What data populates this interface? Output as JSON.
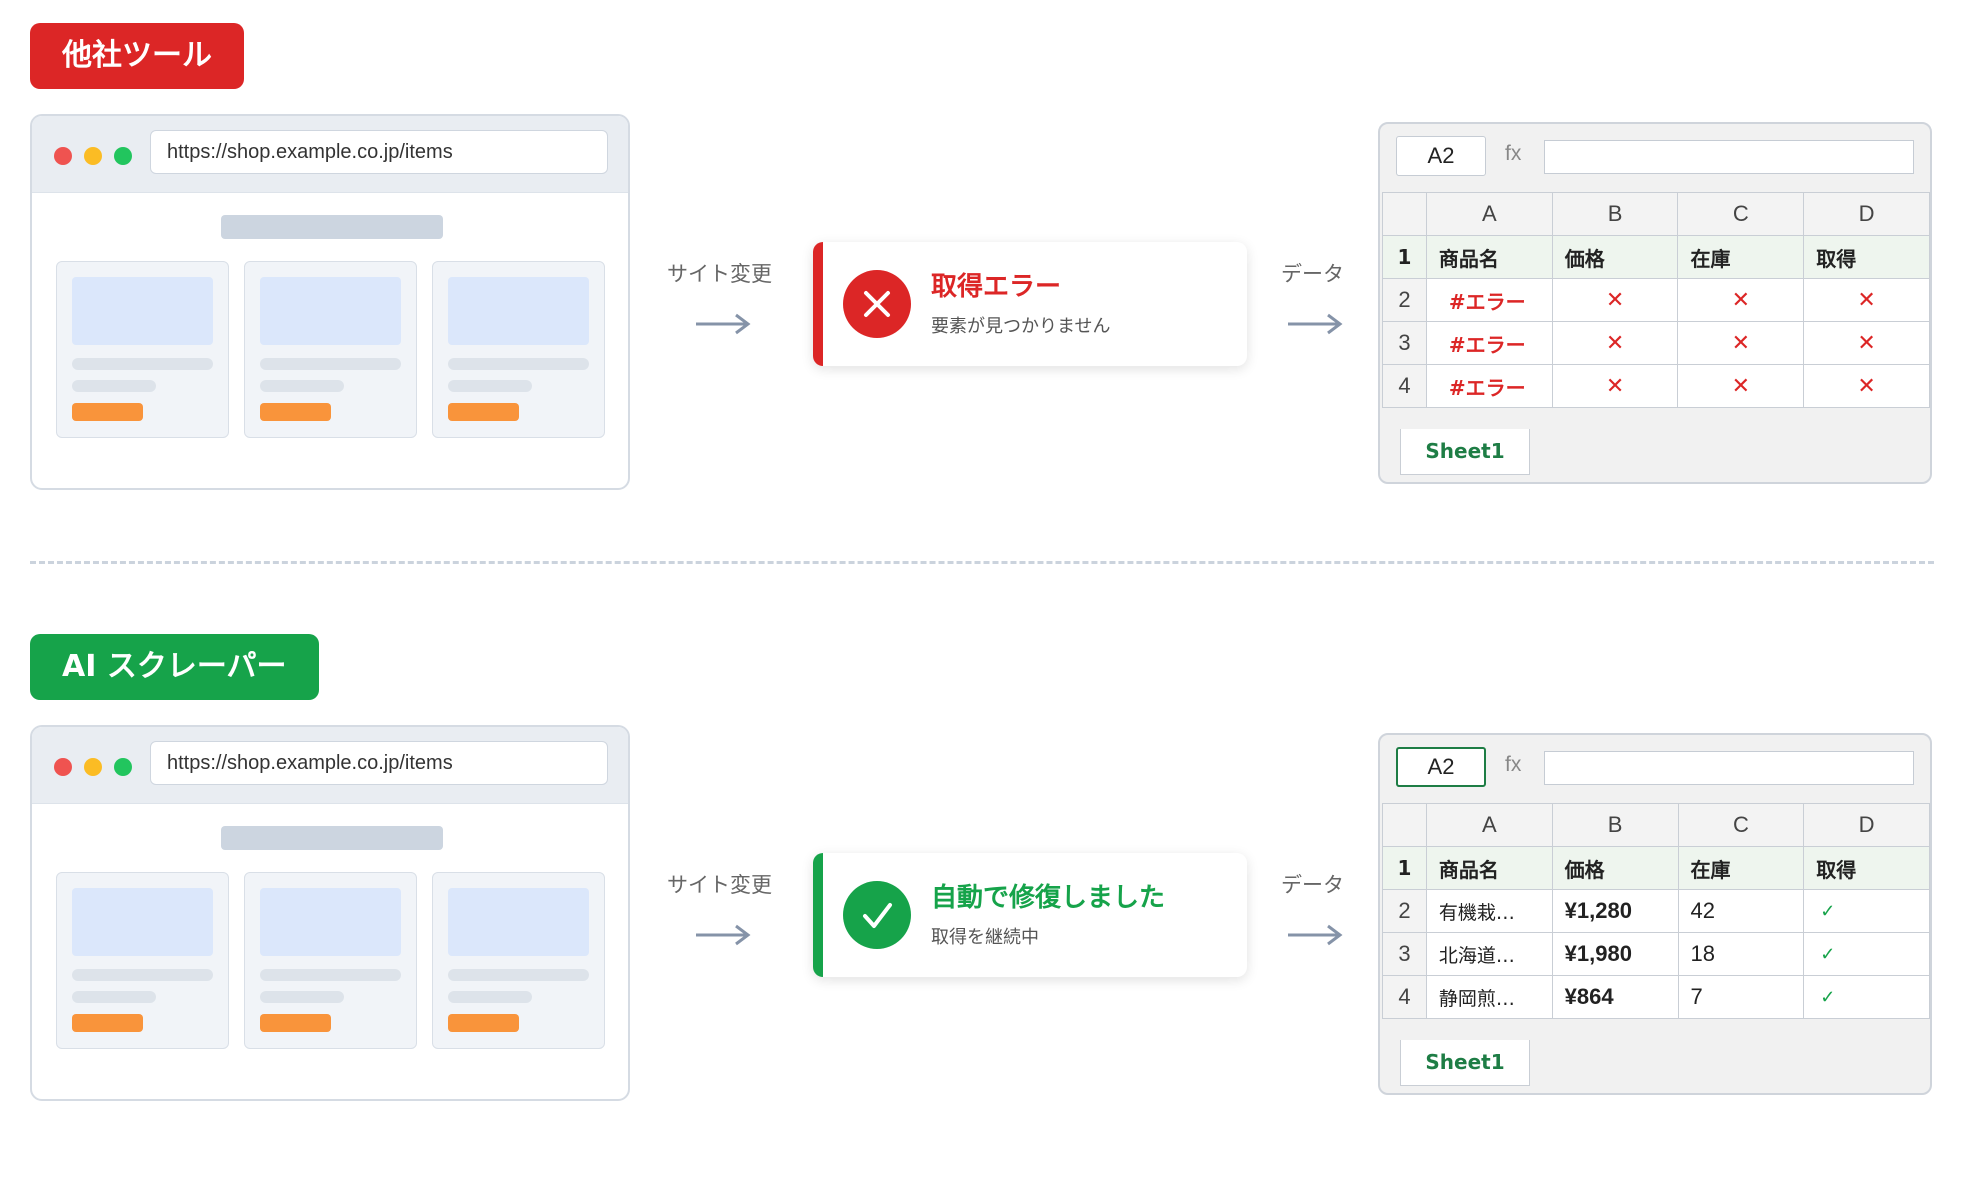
{
  "top": {
    "badge": "他社ツール",
    "url": "https://shop.example.co.jp/items",
    "arrow1_label": "サイト変更",
    "status_title": "取得エラー",
    "status_sub": "要素が見つかりません",
    "arrow2_label": "データ",
    "sheet": {
      "namebox": "A2",
      "fx": "fx",
      "cols": [
        "A",
        "B",
        "C",
        "D"
      ],
      "header_row": {
        "n": "1",
        "cells": [
          "商品名",
          "価格",
          "在庫",
          "取得"
        ]
      },
      "rows": [
        {
          "n": "2",
          "cells": [
            "#エラー",
            "✕",
            "✕",
            "✕"
          ]
        },
        {
          "n": "3",
          "cells": [
            "#エラー",
            "✕",
            "✕",
            "✕"
          ]
        },
        {
          "n": "4",
          "cells": [
            "#エラー",
            "✕",
            "✕",
            "✕"
          ]
        }
      ],
      "tab": "Sheet1"
    }
  },
  "bottom": {
    "badge": "AI スクレーパー",
    "url": "https://shop.example.co.jp/items",
    "arrow1_label": "サイト変更",
    "status_title": "自動で修復しました",
    "status_sub": "取得を継続中",
    "arrow2_label": "データ",
    "sheet": {
      "namebox": "A2",
      "fx": "fx",
      "cols": [
        "A",
        "B",
        "C",
        "D"
      ],
      "header_row": {
        "n": "1",
        "cells": [
          "商品名",
          "価格",
          "在庫",
          "取得"
        ]
      },
      "rows": [
        {
          "n": "2",
          "cells": [
            "有機栽…",
            "¥1,280",
            "42",
            "✓"
          ]
        },
        {
          "n": "3",
          "cells": [
            "北海道…",
            "¥1,980",
            "18",
            "✓"
          ]
        },
        {
          "n": "4",
          "cells": [
            "静岡煎…",
            "¥864",
            "7",
            "✓"
          ]
        }
      ],
      "tab": "Sheet1"
    }
  },
  "colors": {
    "error": "#dc2626",
    "success": "#16a34a",
    "sheet_green": "#1e7d45",
    "orange": "#f9943b"
  },
  "icons": {
    "error": "close-icon",
    "success": "check-icon",
    "arrow": "arrow-right-icon"
  }
}
